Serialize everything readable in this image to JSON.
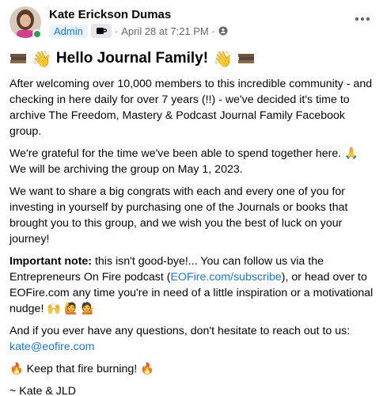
{
  "post": {
    "author": "Kate Erickson Dumas",
    "role_badge": "Admin",
    "date": "April 28 at 7:21 PM",
    "separator": "·",
    "title": "Hello Journal Family!",
    "p1": "After welcoming over 10,000 members to this incredible community - and checking in here daily for over 7 years (!!) - we've decided it's time to archive The Freedom, Mastery & Podcast Journal Family Facebook group.",
    "p2a": "We're grateful for the time we've been able to spend together here.",
    "p2b": "We will be archiving the group on May 1, 2023.",
    "p3": "We want to share a big congrats with each and every one of you for investing in yourself by purchasing one of the Journals or books that brought you to this group, and we wish you the best of luck on your journey!",
    "p4_label": "Important note:",
    "p4_text1": " this isn't good-bye!... You can follow us via the Entrepreneurs On Fire podcast (",
    "p4_link": "EOFire.com/subscribe",
    "p4_text2": "), or head over to EOFire.com any time you're in need of a little inspiration or a motivational nudge!",
    "p5_text": "And if you ever have any questions, don't hesitate to reach out to us: ",
    "p5_email": "kate@eofire.com",
    "p6": "Keep that fire burning!",
    "p7": "~ Kate & JLD"
  },
  "colors": {
    "link": "#1877f2",
    "meta": "#65676b",
    "online": "#31a24c"
  }
}
